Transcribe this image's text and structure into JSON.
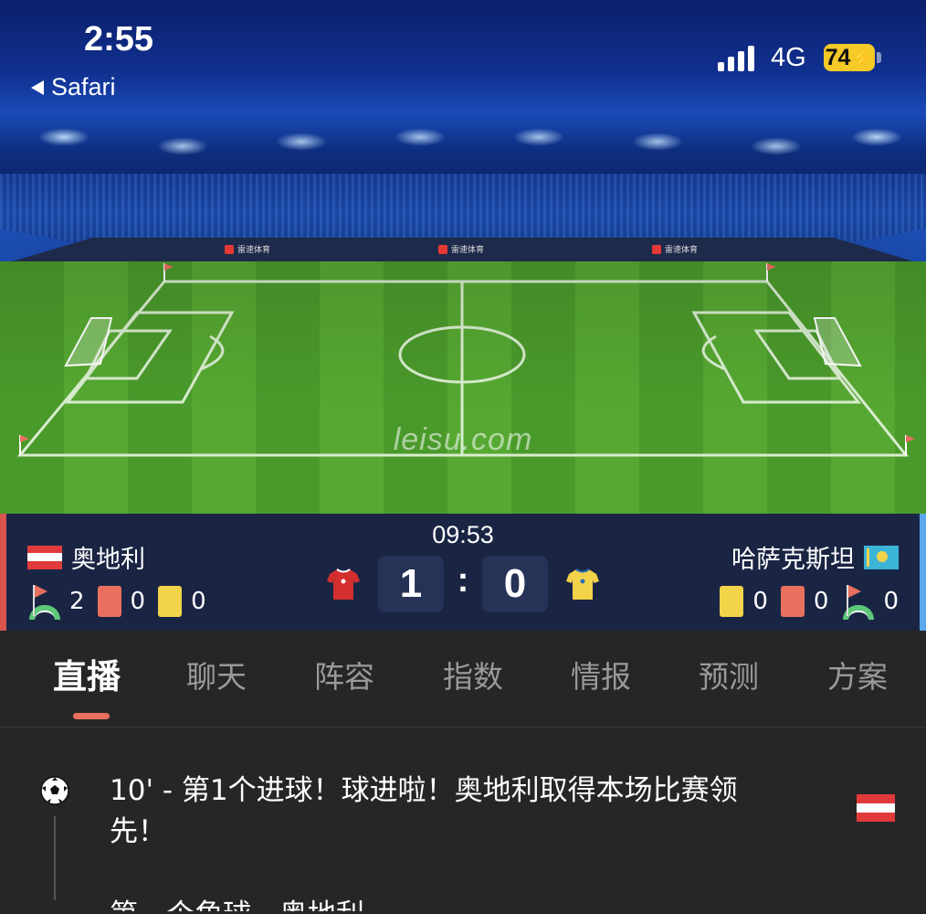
{
  "status_bar": {
    "time": "2:55",
    "back_app": "Safari",
    "network": "4G",
    "battery": "74"
  },
  "hero": {
    "watermark": "leisu.com",
    "ad_text": "雷速体育"
  },
  "match": {
    "clock": "09:53",
    "home": {
      "name": "奥地利",
      "score": "1",
      "corners": "2",
      "red_cards": "0",
      "yellow_cards": "0",
      "flag_colors": [
        "#e23a3a",
        "#ffffff",
        "#e23a3a"
      ],
      "jersey_color": "#d32f2f"
    },
    "away": {
      "name": "哈萨克斯坦",
      "score": "0",
      "corners": "0",
      "red_cards": "0",
      "yellow_cards": "0",
      "flag_color": "#3bb4d8",
      "jersey_color": "#f3d34a"
    },
    "separator": ":"
  },
  "tabs": [
    {
      "label": "直播",
      "active": true
    },
    {
      "label": "聊天"
    },
    {
      "label": "阵容"
    },
    {
      "label": "指数"
    },
    {
      "label": "情报"
    },
    {
      "label": "预测"
    },
    {
      "label": "方案"
    }
  ],
  "feed": {
    "events": [
      {
        "icon": "soccer-ball-icon",
        "text": "10' - 第1个进球！球进啦！奥地利取得本场比赛领先！",
        "team_flag": "austria"
      },
      {
        "text": "第一个角球 - 奥地利"
      }
    ]
  }
}
